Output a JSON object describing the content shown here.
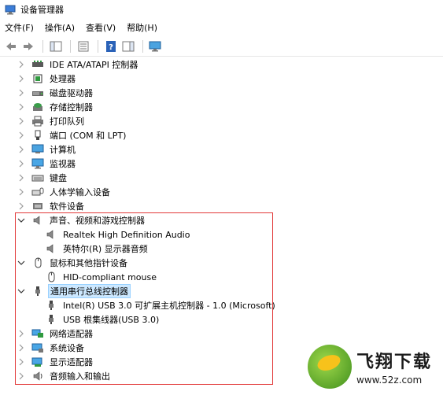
{
  "window": {
    "title": "设备管理器"
  },
  "menu": {
    "items": [
      "文件(F)",
      "操作(A)",
      "查看(V)",
      "帮助(H)"
    ]
  },
  "tree": [
    {
      "label": "IDE ATA/ATAPI 控制器",
      "expanded": false,
      "icon": "ide-controller-icon"
    },
    {
      "label": "处理器",
      "expanded": false,
      "icon": "processor-icon"
    },
    {
      "label": "磁盘驱动器",
      "expanded": false,
      "icon": "disk-drive-icon"
    },
    {
      "label": "存储控制器",
      "expanded": false,
      "icon": "storage-controller-icon"
    },
    {
      "label": "打印队列",
      "expanded": false,
      "icon": "printer-icon"
    },
    {
      "label": "端口 (COM 和 LPT)",
      "expanded": false,
      "icon": "port-icon"
    },
    {
      "label": "计算机",
      "expanded": false,
      "icon": "computer-icon"
    },
    {
      "label": "监视器",
      "expanded": false,
      "icon": "monitor-icon"
    },
    {
      "label": "键盘",
      "expanded": false,
      "icon": "keyboard-icon"
    },
    {
      "label": "人体学输入设备",
      "expanded": false,
      "icon": "hid-icon"
    },
    {
      "label": "软件设备",
      "expanded": false,
      "icon": "software-device-icon"
    },
    {
      "label": "声音、视频和游戏控制器",
      "expanded": true,
      "icon": "speaker-icon",
      "children": [
        "Realtek High Definition Audio",
        "英特尔(R) 显示器音频"
      ]
    },
    {
      "label": "鼠标和其他指针设备",
      "expanded": true,
      "icon": "mouse-icon",
      "children": [
        "HID-compliant mouse"
      ]
    },
    {
      "label": "通用串行总线控制器",
      "expanded": true,
      "selected": true,
      "icon": "usb-icon",
      "children": [
        "Intel(R) USB 3.0 可扩展主机控制器 - 1.0 (Microsoft)",
        "USB 根集线器(USB 3.0)"
      ]
    },
    {
      "label": "网络适配器",
      "expanded": false,
      "icon": "network-adapter-icon"
    },
    {
      "label": "系统设备",
      "expanded": false,
      "icon": "system-device-icon"
    },
    {
      "label": "显示适配器",
      "expanded": false,
      "icon": "display-adapter-icon"
    },
    {
      "label": "音频输入和输出",
      "expanded": false,
      "icon": "audio-io-icon"
    }
  ],
  "watermark": {
    "brand": "飞翔下载",
    "url": "www.52z.com"
  },
  "colors": {
    "highlight": "#e23a3a",
    "selection": "#cce8ff"
  }
}
